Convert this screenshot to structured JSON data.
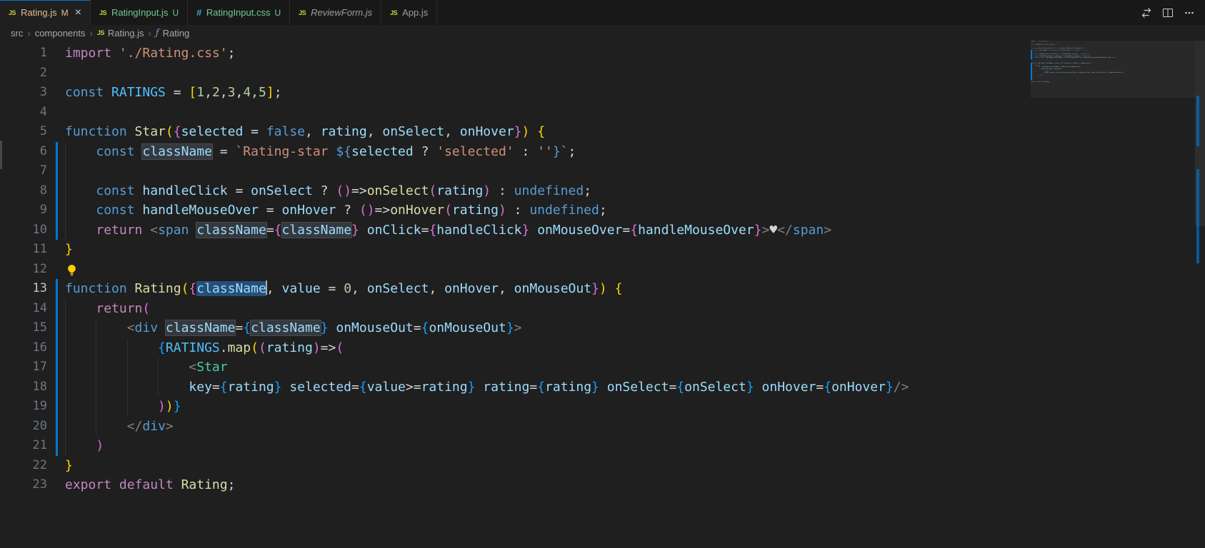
{
  "colors": {
    "accent": "#0078d4",
    "git_modified": "#E2C08D",
    "git_untracked": "#73C991",
    "selection": "#264F78",
    "bracket_levels": [
      "#FFD700",
      "#DA70D6",
      "#179FFF"
    ]
  },
  "tab_bar": {
    "tabs": [
      {
        "label": "Rating.js",
        "icon": "js",
        "badge": "M",
        "badge_type": "modified",
        "active": true,
        "show_close": true
      },
      {
        "label": "RatingInput.js",
        "icon": "js",
        "badge": "U",
        "badge_type": "untracked"
      },
      {
        "label": "RatingInput.css",
        "icon": "css",
        "badge": "U",
        "badge_type": "untracked"
      },
      {
        "label": "ReviewForm.js",
        "icon": "js",
        "italic": true
      },
      {
        "label": "App.js",
        "icon": "js"
      }
    ],
    "actions": [
      "open-changes",
      "split-editor",
      "more-actions"
    ]
  },
  "breadcrumbs": [
    {
      "label": "src"
    },
    {
      "label": "components"
    },
    {
      "label": "Rating.js",
      "icon": "js"
    },
    {
      "label": "Rating",
      "icon": "symbol-function"
    }
  ],
  "editor": {
    "cursor_line": 13,
    "lightbulb_line": 12,
    "modified_lines": [
      6,
      7,
      8,
      9,
      10,
      13,
      14,
      15,
      16,
      17,
      18,
      19,
      20,
      21
    ],
    "lines": [
      {
        "n": 1,
        "g": 0,
        "s": [
          [
            "import ",
            "k1"
          ],
          [
            "'./Rating.css'",
            "st"
          ],
          [
            ";",
            "tx"
          ]
        ]
      },
      {
        "n": 2,
        "g": 0,
        "s": []
      },
      {
        "n": 3,
        "g": 0,
        "s": [
          [
            "const ",
            "k2"
          ],
          [
            "RATINGS",
            "ct"
          ],
          [
            " = ",
            "tx"
          ],
          [
            "[",
            "b1"
          ],
          [
            "1",
            "nm"
          ],
          [
            ",",
            "tx"
          ],
          [
            "2",
            "nm"
          ],
          [
            ",",
            "tx"
          ],
          [
            "3",
            "nm"
          ],
          [
            ",",
            "tx"
          ],
          [
            "4",
            "nm"
          ],
          [
            ",",
            "tx"
          ],
          [
            "5",
            "nm"
          ],
          [
            "]",
            "b1"
          ],
          [
            ";",
            "tx"
          ]
        ]
      },
      {
        "n": 4,
        "g": 0,
        "s": []
      },
      {
        "n": 5,
        "g": 0,
        "s": [
          [
            "function ",
            "k2"
          ],
          [
            "Star",
            "fn"
          ],
          [
            "(",
            "b1"
          ],
          [
            "{",
            "b2"
          ],
          [
            "selected",
            "vr"
          ],
          [
            " = ",
            "tx"
          ],
          [
            "false",
            "k2"
          ],
          [
            ", ",
            "tx"
          ],
          [
            "rating",
            "vr"
          ],
          [
            ", ",
            "tx"
          ],
          [
            "onSelect",
            "vr"
          ],
          [
            ", ",
            "tx"
          ],
          [
            "onHover",
            "vr"
          ],
          [
            "}",
            "b2"
          ],
          [
            ")",
            "b1"
          ],
          [
            " ",
            "tx"
          ],
          [
            "{",
            "b1"
          ]
        ]
      },
      {
        "n": 6,
        "g": 1,
        "s": [
          [
            "    ",
            "tx"
          ],
          [
            "const ",
            "k2"
          ],
          [
            "className",
            "vr",
            "w"
          ],
          [
            " = ",
            "tx"
          ],
          [
            "`Rating-star ",
            "st"
          ],
          [
            "${",
            "k2"
          ],
          [
            "selected",
            "vr"
          ],
          [
            " ? ",
            "tx"
          ],
          [
            "'selected'",
            "st"
          ],
          [
            " : ",
            "tx"
          ],
          [
            "''",
            "st"
          ],
          [
            "}",
            "k2"
          ],
          [
            "`",
            "st"
          ],
          [
            ";",
            "tx"
          ]
        ]
      },
      {
        "n": 7,
        "g": 1,
        "s": []
      },
      {
        "n": 8,
        "g": 1,
        "s": [
          [
            "    ",
            "tx"
          ],
          [
            "const ",
            "k2"
          ],
          [
            "handleClick",
            "vr"
          ],
          [
            " = ",
            "tx"
          ],
          [
            "onSelect",
            "vr"
          ],
          [
            " ? ",
            "tx"
          ],
          [
            "(",
            "b2"
          ],
          [
            ")",
            "b2"
          ],
          [
            "=>",
            "tx"
          ],
          [
            "onSelect",
            "fn"
          ],
          [
            "(",
            "b2"
          ],
          [
            "rating",
            "vr"
          ],
          [
            ")",
            "b2"
          ],
          [
            " : ",
            "tx"
          ],
          [
            "undefined",
            "k2"
          ],
          [
            ";",
            "tx"
          ]
        ]
      },
      {
        "n": 9,
        "g": 1,
        "s": [
          [
            "    ",
            "tx"
          ],
          [
            "const ",
            "k2"
          ],
          [
            "handleMouseOver",
            "vr"
          ],
          [
            " = ",
            "tx"
          ],
          [
            "onHover",
            "vr"
          ],
          [
            " ? ",
            "tx"
          ],
          [
            "(",
            "b2"
          ],
          [
            ")",
            "b2"
          ],
          [
            "=>",
            "tx"
          ],
          [
            "onHover",
            "fn"
          ],
          [
            "(",
            "b2"
          ],
          [
            "rating",
            "vr"
          ],
          [
            ")",
            "b2"
          ],
          [
            " : ",
            "tx"
          ],
          [
            "undefined",
            "k2"
          ],
          [
            ";",
            "tx"
          ]
        ]
      },
      {
        "n": 10,
        "g": 1,
        "s": [
          [
            "    ",
            "tx"
          ],
          [
            "return ",
            "k1"
          ],
          [
            "<",
            "tb"
          ],
          [
            "span",
            "k2"
          ],
          [
            " ",
            "tx"
          ],
          [
            "className",
            "vr",
            "w"
          ],
          [
            "=",
            "tx"
          ],
          [
            "{",
            "b2"
          ],
          [
            "className",
            "vr",
            "w"
          ],
          [
            "}",
            "b2"
          ],
          [
            " ",
            "tx"
          ],
          [
            "onClick",
            "vr"
          ],
          [
            "=",
            "tx"
          ],
          [
            "{",
            "b2"
          ],
          [
            "handleClick",
            "vr"
          ],
          [
            "}",
            "b2"
          ],
          [
            " ",
            "tx"
          ],
          [
            "onMouseOver",
            "vr"
          ],
          [
            "=",
            "tx"
          ],
          [
            "{",
            "b2"
          ],
          [
            "handleMouseOver",
            "vr"
          ],
          [
            "}",
            "b2"
          ],
          [
            ">",
            "tb"
          ],
          [
            "♥",
            "tx"
          ],
          [
            "</",
            "tb"
          ],
          [
            "span",
            "k2"
          ],
          [
            ">",
            "tb"
          ]
        ]
      },
      {
        "n": 11,
        "g": 0,
        "s": [
          [
            "}",
            "b1"
          ]
        ]
      },
      {
        "n": 12,
        "g": 0,
        "s": []
      },
      {
        "n": 13,
        "g": 0,
        "s": [
          [
            "function ",
            "k2"
          ],
          [
            "Rating",
            "fn"
          ],
          [
            "(",
            "b1"
          ],
          [
            "{",
            "b2"
          ],
          [
            "className",
            "vr",
            "s"
          ],
          [
            ", ",
            "tx"
          ],
          [
            "value",
            "vr"
          ],
          [
            " = ",
            "tx"
          ],
          [
            "0",
            "nm"
          ],
          [
            ", ",
            "tx"
          ],
          [
            "onSelect",
            "vr"
          ],
          [
            ", ",
            "tx"
          ],
          [
            "onHover",
            "vr"
          ],
          [
            ", ",
            "tx"
          ],
          [
            "onMouseOut",
            "vr"
          ],
          [
            "}",
            "b2"
          ],
          [
            ")",
            "b1"
          ],
          [
            " ",
            "tx"
          ],
          [
            "{",
            "b1"
          ]
        ]
      },
      {
        "n": 14,
        "g": 1,
        "s": [
          [
            "    ",
            "tx"
          ],
          [
            "return",
            "k1"
          ],
          [
            "(",
            "b2"
          ]
        ]
      },
      {
        "n": 15,
        "g": 2,
        "s": [
          [
            "        ",
            "tx"
          ],
          [
            "<",
            "tb"
          ],
          [
            "div",
            "k2"
          ],
          [
            " ",
            "tx"
          ],
          [
            "className",
            "vr",
            "w"
          ],
          [
            "=",
            "tx"
          ],
          [
            "{",
            "b3"
          ],
          [
            "className",
            "vr",
            "w"
          ],
          [
            "}",
            "b3"
          ],
          [
            " ",
            "tx"
          ],
          [
            "onMouseOut",
            "vr"
          ],
          [
            "=",
            "tx"
          ],
          [
            "{",
            "b3"
          ],
          [
            "onMouseOut",
            "vr"
          ],
          [
            "}",
            "b3"
          ],
          [
            ">",
            "tb"
          ]
        ]
      },
      {
        "n": 16,
        "g": 3,
        "s": [
          [
            "            ",
            "tx"
          ],
          [
            "{",
            "b3"
          ],
          [
            "RATINGS",
            "ct"
          ],
          [
            ".",
            "tx"
          ],
          [
            "map",
            "fn"
          ],
          [
            "(",
            "b1"
          ],
          [
            "(",
            "b2"
          ],
          [
            "rating",
            "vr"
          ],
          [
            ")",
            "b2"
          ],
          [
            "=>",
            "tx"
          ],
          [
            "(",
            "b2"
          ]
        ]
      },
      {
        "n": 17,
        "g": 4,
        "s": [
          [
            "                ",
            "tx"
          ],
          [
            "<",
            "tb"
          ],
          [
            "Star",
            "cp"
          ]
        ]
      },
      {
        "n": 18,
        "g": 4,
        "s": [
          [
            "                ",
            "tx"
          ],
          [
            "key",
            "vr"
          ],
          [
            "=",
            "tx"
          ],
          [
            "{",
            "b3"
          ],
          [
            "rating",
            "vr"
          ],
          [
            "}",
            "b3"
          ],
          [
            " ",
            "tx"
          ],
          [
            "selected",
            "vr"
          ],
          [
            "=",
            "tx"
          ],
          [
            "{",
            "b3"
          ],
          [
            "value",
            "vr"
          ],
          [
            ">=",
            "tx"
          ],
          [
            "rating",
            "vr"
          ],
          [
            "}",
            "b3"
          ],
          [
            " ",
            "tx"
          ],
          [
            "rating",
            "vr"
          ],
          [
            "=",
            "tx"
          ],
          [
            "{",
            "b3"
          ],
          [
            "rating",
            "vr"
          ],
          [
            "}",
            "b3"
          ],
          [
            " ",
            "tx"
          ],
          [
            "onSelect",
            "vr"
          ],
          [
            "=",
            "tx"
          ],
          [
            "{",
            "b3"
          ],
          [
            "onSelect",
            "vr"
          ],
          [
            "}",
            "b3"
          ],
          [
            " ",
            "tx"
          ],
          [
            "onHover",
            "vr"
          ],
          [
            "=",
            "tx"
          ],
          [
            "{",
            "b3"
          ],
          [
            "onHover",
            "vr"
          ],
          [
            "}",
            "b3"
          ],
          [
            "/>",
            "tb"
          ]
        ]
      },
      {
        "n": 19,
        "g": 3,
        "s": [
          [
            "            ",
            "tx"
          ],
          [
            ")",
            "b2"
          ],
          [
            ")",
            "b1"
          ],
          [
            "}",
            "b3"
          ]
        ]
      },
      {
        "n": 20,
        "g": 2,
        "s": [
          [
            "        ",
            "tx"
          ],
          [
            "</",
            "tb"
          ],
          [
            "div",
            "k2"
          ],
          [
            ">",
            "tb"
          ]
        ]
      },
      {
        "n": 21,
        "g": 1,
        "s": [
          [
            "    ",
            "tx"
          ],
          [
            ")",
            "b2"
          ]
        ]
      },
      {
        "n": 22,
        "g": 0,
        "s": [
          [
            "}",
            "b1"
          ]
        ]
      },
      {
        "n": 23,
        "g": 0,
        "s": [
          [
            "export ",
            "k1"
          ],
          [
            "default ",
            "k1"
          ],
          [
            "Rating",
            "fn"
          ],
          [
            ";",
            "tx"
          ]
        ]
      }
    ]
  }
}
